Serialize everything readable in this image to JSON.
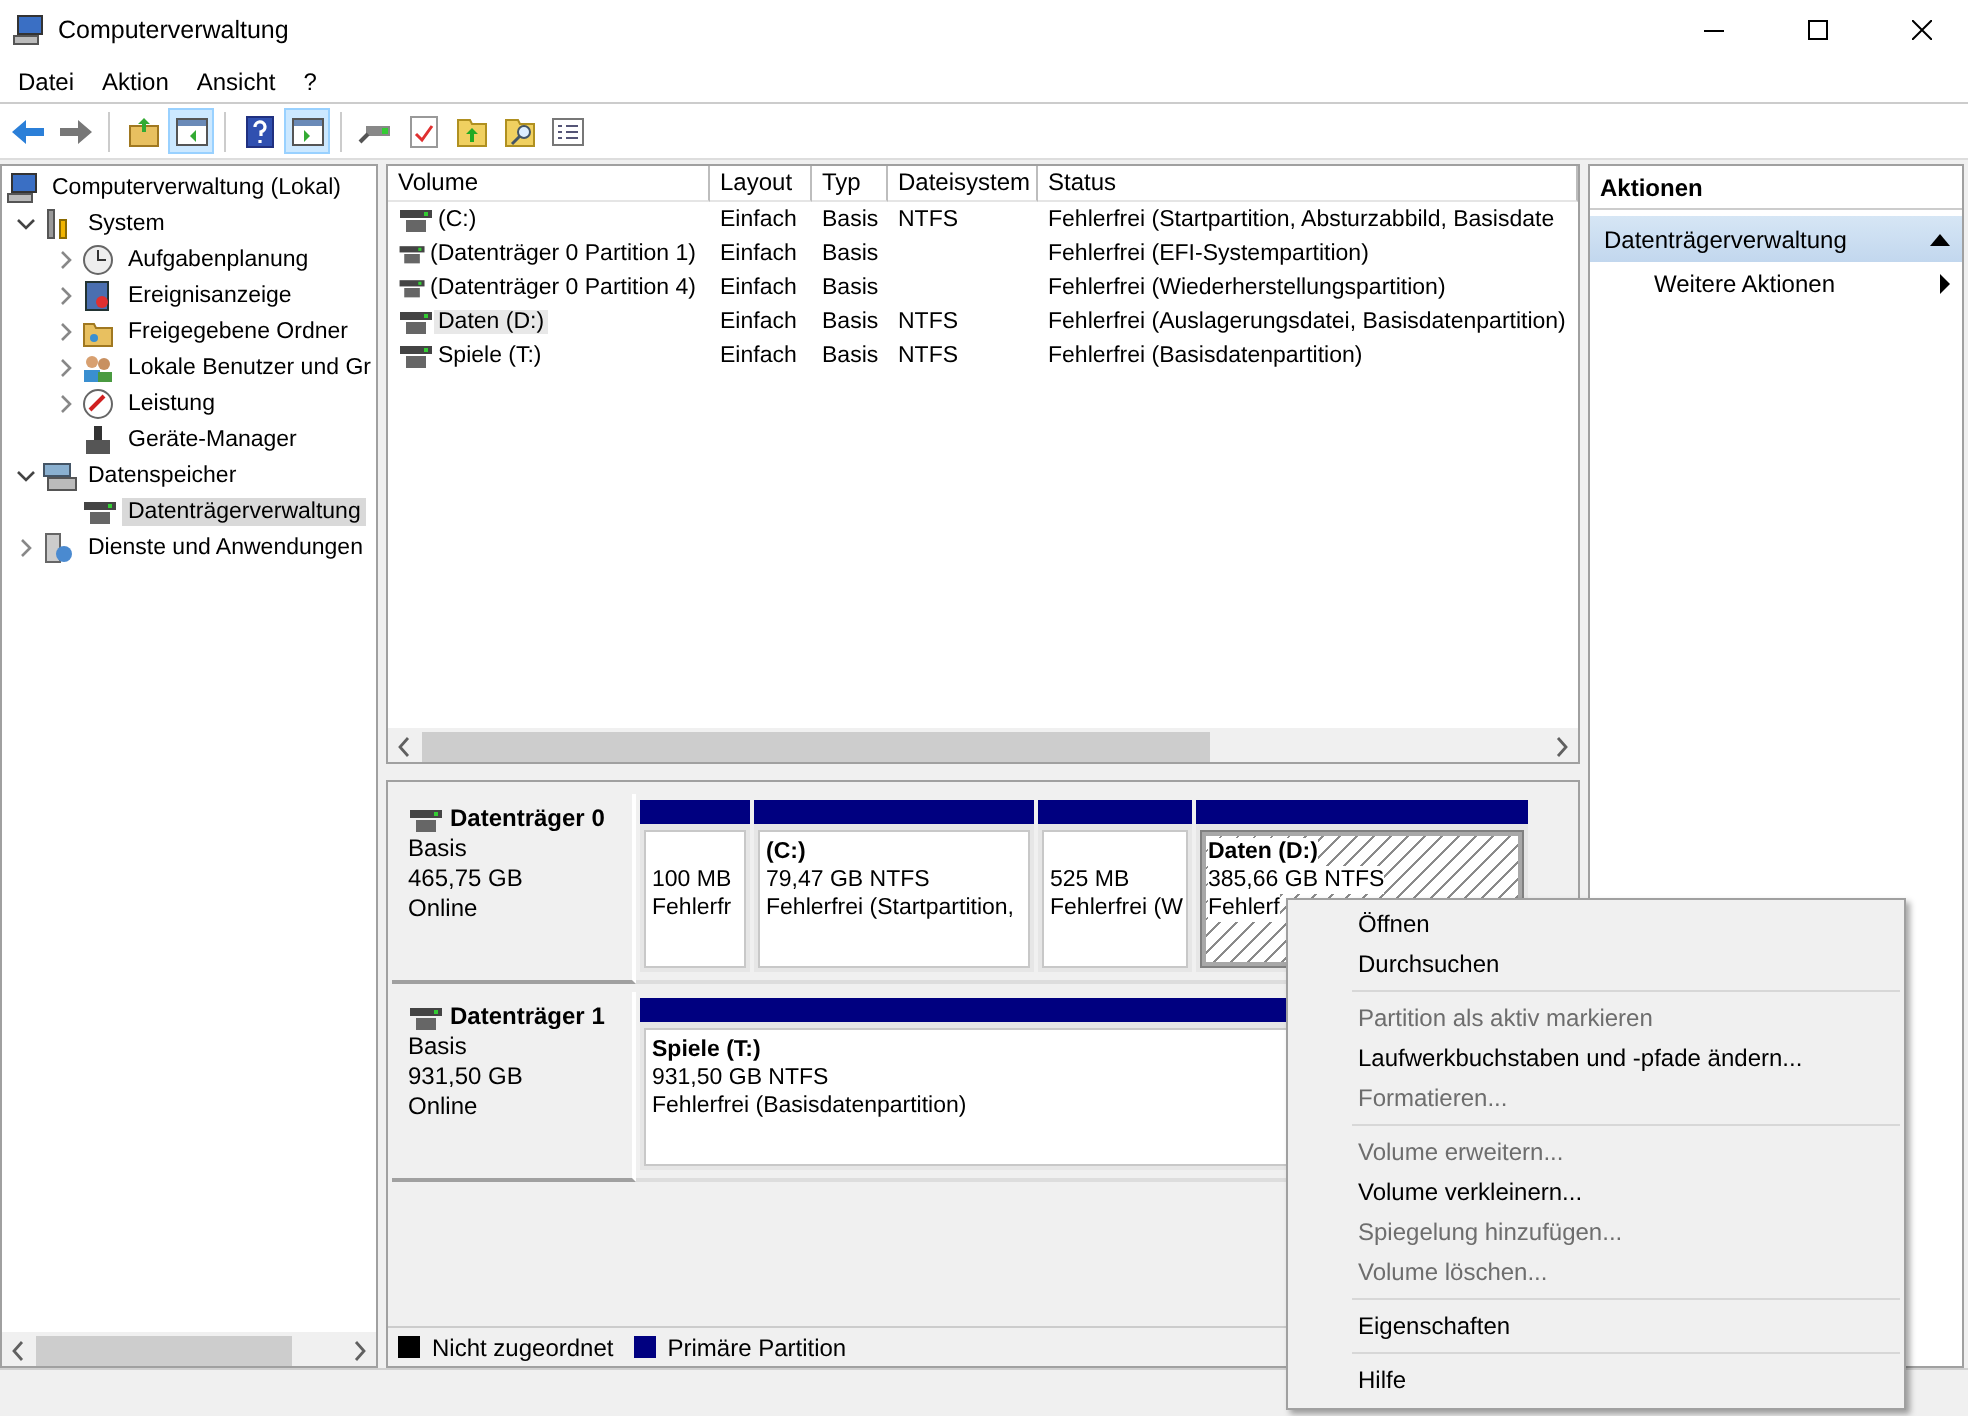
{
  "window": {
    "title": "Computerverwaltung"
  },
  "menu_bar": [
    "Datei",
    "Aktion",
    "Ansicht",
    "?"
  ],
  "toolbar": [
    [
      {
        "kind": "back",
        "pressed": false
      },
      {
        "kind": "forward",
        "pressed": false
      }
    ],
    [
      {
        "kind": "folder-up",
        "pressed": false
      },
      {
        "kind": "console-tree",
        "pressed": true
      }
    ],
    [
      {
        "kind": "help",
        "pressed": false
      },
      {
        "kind": "action-pane",
        "pressed": true
      }
    ],
    [
      {
        "kind": "plug",
        "pressed": false
      },
      {
        "kind": "checklist",
        "pressed": false
      },
      {
        "kind": "export",
        "pressed": false
      },
      {
        "kind": "search-folder",
        "pressed": false
      },
      {
        "kind": "properties",
        "pressed": false
      }
    ]
  ],
  "tree": {
    "label": "Computerverwaltung (Lokal)",
    "kind": "computer",
    "selected": false,
    "children": [
      {
        "label": "System",
        "kind": "tools",
        "expanded": true,
        "selected": false,
        "children": [
          {
            "label": "Aufgabenplanung",
            "kind": "clock",
            "expanded": false,
            "selected": false
          },
          {
            "label": "Ereignisanzeige",
            "kind": "event",
            "expanded": false,
            "selected": false
          },
          {
            "label": "Freigegebene Ordner",
            "kind": "share",
            "expanded": false,
            "selected": false
          },
          {
            "label": "Lokale Benutzer und Gr",
            "kind": "users",
            "expanded": false,
            "selected": false
          },
          {
            "label": "Leistung",
            "kind": "gauge",
            "expanded": false,
            "selected": false
          },
          {
            "label": "Geräte-Manager",
            "kind": "device",
            "selected": false
          }
        ]
      },
      {
        "label": "Datenspeicher",
        "kind": "storage",
        "expanded": true,
        "selected": false,
        "children": [
          {
            "label": "Datenträgerverwaltung",
            "kind": "disk",
            "selected": true
          }
        ]
      },
      {
        "label": "Dienste und Anwendungen",
        "kind": "services",
        "expanded": false,
        "selected": false
      }
    ]
  },
  "volumes": {
    "columns": [
      "Volume",
      "Layout",
      "Typ",
      "Dateisystem",
      "Status"
    ],
    "rows": [
      {
        "cells": [
          "(C:)",
          "Einfach",
          "Basis",
          "NTFS",
          "Fehlerfrei (Startpartition, Absturzabbild, Basisdate"
        ],
        "selected": false
      },
      {
        "cells": [
          "(Datenträger 0 Partition 1)",
          "Einfach",
          "Basis",
          "",
          "Fehlerfrei (EFI-Systempartition)"
        ],
        "selected": false
      },
      {
        "cells": [
          "(Datenträger 0 Partition 4)",
          "Einfach",
          "Basis",
          "",
          "Fehlerfrei (Wiederherstellungspartition)"
        ],
        "selected": false
      },
      {
        "cells": [
          "Daten (D:)",
          "Einfach",
          "Basis",
          "NTFS",
          "Fehlerfrei (Auslagerungsdatei, Basisdatenpartition)"
        ],
        "selected": true
      },
      {
        "cells": [
          "Spiele (T:)",
          "Einfach",
          "Basis",
          "NTFS",
          "Fehlerfrei (Basisdatenpartition)"
        ],
        "selected": false
      }
    ]
  },
  "disks": [
    {
      "name": "Datenträger 0",
      "type": "Basis",
      "size": "465,75 GB",
      "status": "Online",
      "partitions": [
        {
          "size": "100 MB",
          "status": "Fehlerfr",
          "selected": false
        },
        {
          "label": "(C:)",
          "size": "79,47 GB NTFS",
          "status": "Fehlerfrei (Startpartition,",
          "selected": false
        },
        {
          "size": "525 MB",
          "status": "Fehlerfrei (W",
          "selected": false
        },
        {
          "label": "Daten  (D:)",
          "size": "385,66 GB NTFS",
          "status": "Fehlerf",
          "selected": true
        }
      ]
    },
    {
      "name": "Datenträger 1",
      "type": "Basis",
      "size": "931,50 GB",
      "status": "Online",
      "partitions": [
        {
          "label": "Spiele  (T:)",
          "size": "931,50 GB NTFS",
          "status": "Fehlerfrei (Basisdatenpartition)",
          "selected": false
        }
      ]
    }
  ],
  "legend": [
    {
      "label": "Nicht zugeordnet",
      "color": "#000000"
    },
    {
      "label": "Primäre Partition",
      "color": "#000080"
    }
  ],
  "actions": {
    "title": "Aktionen",
    "section": {
      "label": "Datenträgerverwaltung",
      "expanded": true
    },
    "items": [
      "Weitere Aktionen"
    ]
  },
  "context_menu": [
    [
      {
        "label": "Öffnen",
        "disabled": false
      },
      {
        "label": "Durchsuchen",
        "disabled": false
      }
    ],
    [
      {
        "label": "Partition als aktiv markieren",
        "disabled": true
      },
      {
        "label": "Laufwerkbuchstaben und -pfade ändern...",
        "disabled": false
      },
      {
        "label": "Formatieren...",
        "disabled": true
      }
    ],
    [
      {
        "label": "Volume erweitern...",
        "disabled": true
      },
      {
        "label": "Volume verkleinern...",
        "disabled": false
      },
      {
        "label": "Spiegelung hinzufügen...",
        "disabled": true
      },
      {
        "label": "Volume löschen...",
        "disabled": true
      }
    ],
    [
      {
        "label": "Eigenschaften",
        "disabled": false
      }
    ],
    [
      {
        "label": "Hilfe",
        "disabled": false
      }
    ]
  ]
}
